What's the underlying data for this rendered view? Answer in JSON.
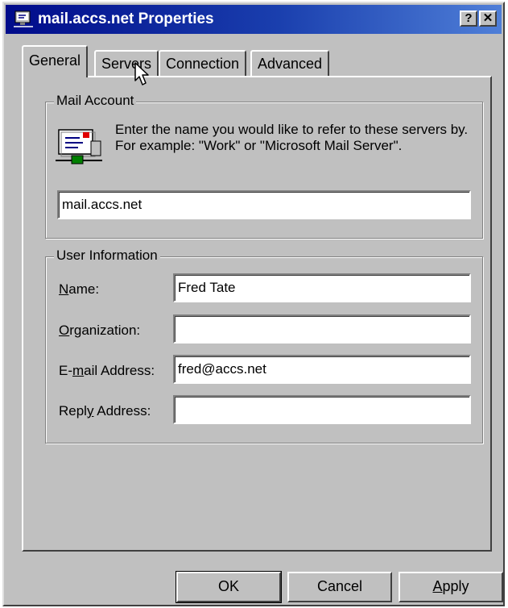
{
  "window": {
    "title": "mail.accs.net Properties",
    "help_glyph": "?",
    "close_glyph": "✕"
  },
  "tabs": [
    {
      "label": "General",
      "active": true
    },
    {
      "label": "Servers",
      "active": false
    },
    {
      "label": "Connection",
      "active": false
    },
    {
      "label": "Advanced",
      "active": false
    }
  ],
  "mail_account": {
    "group_label": "Mail Account",
    "description": "Enter the name you would like to refer to these servers by.  For example: \"Work\" or \"Microsoft Mail Server\".",
    "account_name_value": "mail.accs.net"
  },
  "user_information": {
    "group_label": "User Information",
    "fields": [
      {
        "label": "Name:",
        "accel": "N",
        "rest": "ame:",
        "prefix": "",
        "value": "Fred Tate"
      },
      {
        "label": "Organization:",
        "accel": "O",
        "rest": "rganization:",
        "prefix": "",
        "value": ""
      },
      {
        "label": "E-mail Address:",
        "prefix": "E-",
        "accel": "m",
        "rest": "ail Address:",
        "value": "fred@accs.net"
      },
      {
        "label": "Reply Address:",
        "prefix": "Repl",
        "accel": "y",
        "rest": " Address:",
        "value": ""
      }
    ]
  },
  "buttons": {
    "ok_label": "OK",
    "cancel_label": "Cancel",
    "apply_prefix": "",
    "apply_accel": "A",
    "apply_rest": "pply"
  }
}
